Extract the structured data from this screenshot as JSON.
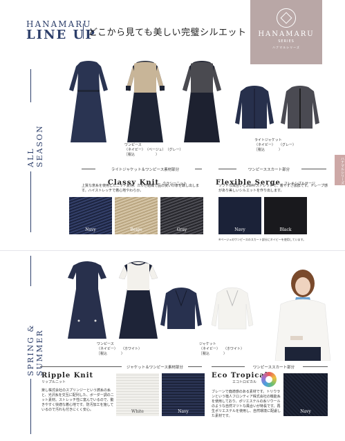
{
  "header": {
    "brand_line1": "HANAMARU",
    "brand_line2": "LINE UP",
    "tagline": "どこから見ても美しい完璧シルエット"
  },
  "logo": {
    "name": "HANAMARU",
    "sub": "SERIES",
    "small": "ハナマルシリーズ"
  },
  "side_tab": "ハナマルシリーズ",
  "seasons": {
    "all_season": "ALL SEASON",
    "spring_summer": "SPRING & SUMMER"
  },
  "all_season": {
    "onepiece_caption": [
      "ワンピース",
      "（ネイビー）　（ベージュ）　（グレー）",
      "［税込　　　　　　）"
    ],
    "jacket_caption": [
      "ライトジャケット",
      "（ネイビー）　　（グレー）",
      "［税込　　　　）"
    ],
    "left": {
      "heading": "ライトジャケット＆ワンピース素材部分",
      "title": "Classy Knit",
      "title_sub": "クラシーニット",
      "body": "上質な意糸を使用したニット素材。カルゼ組織で品の良い印象を醸し出します。ハイストレッチで着心地やわらか。",
      "swatches": [
        {
          "label": "Navy",
          "color": "#2b3550"
        },
        {
          "label": "Beige",
          "color": "#c9b89a"
        },
        {
          "label": "Gray",
          "color": "#3a3a3e"
        }
      ]
    },
    "right": {
      "heading": "ワンピーススカート部分",
      "title": "Flexible Serge",
      "title_sub": "フレキシブルサージ",
      "body": "ソフトな風合いと2WAYストレッチで、着やすさ抜群です。ドレープ感があり美しいシルエットを作り出します。",
      "swatches": [
        {
          "label": "Navy",
          "color": "#1c2338"
        },
        {
          "label": "Black",
          "color": "#1a1a1e"
        }
      ],
      "note": "※ベージュのワンピースのスカート部分にネイビーを使用しています。"
    }
  },
  "spring_summer": {
    "onepiece_caption": [
      "ワンピース",
      "（ネイビー）　　（ホワイト）",
      "［税込　　　　）"
    ],
    "jacket_caption": [
      "ジャケット",
      "（ネイビー）　　（ホワイト）",
      "［税込　　　　）"
    ],
    "left": {
      "heading": "ジャケット＆ワンピース素材部分",
      "title": "Ripple Knit",
      "title_sub": "リップルニット",
      "body": "楽し株式会社のスプリンジーという撚糸の糸と、光沢糸を交互に配列した、ボーダー調のニット素材。ストレッチ性に富んでいるので、動きやすく快適な着心地です。防汚加工を施しているので汚れも付きにくく安心。",
      "swatches": [
        {
          "label": "White",
          "color": "#eeeeea"
        },
        {
          "label": "Navy",
          "color": "#1f2740"
        }
      ]
    },
    "right": {
      "heading": "ワンピーススカート部分",
      "title": "Eco Tropical",
      "title_sub": "エコトロピカル",
      "body": "ブレーンで廃適感のある素材です。トリウランという植人フロンティア株式会社の機能糸を使用しており、ポリエステルの糸リウールのような自然マツトな風合いが特長です。再生ポリエステルを使用し、自然環境に配慮した素材です。",
      "swatches": [
        {
          "label": "Navy",
          "color": "#1a2133"
        }
      ]
    }
  }
}
